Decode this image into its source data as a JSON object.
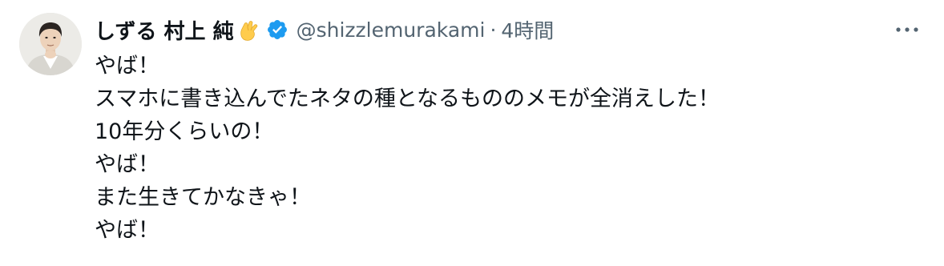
{
  "tweet": {
    "display_name": "しずる 村上 純",
    "name_emoji": "pinching-hand-emoji",
    "verified_icon": "verified-badge-icon",
    "handle": "@shizzlemurakami",
    "separator": "·",
    "timestamp": "4時間",
    "more_icon": "more-horizontal-icon",
    "lines": [
      "やば！",
      "スマホに書き込んでたネタの種となるもののメモが全消えした！",
      "10年分くらいの！",
      "やば！",
      "また生きてかなきゃ！",
      "やば！"
    ]
  },
  "colors": {
    "text_primary": "#0f1419",
    "text_secondary": "#536471",
    "verified_blue": "#1d9bf0",
    "background": "#ffffff"
  }
}
